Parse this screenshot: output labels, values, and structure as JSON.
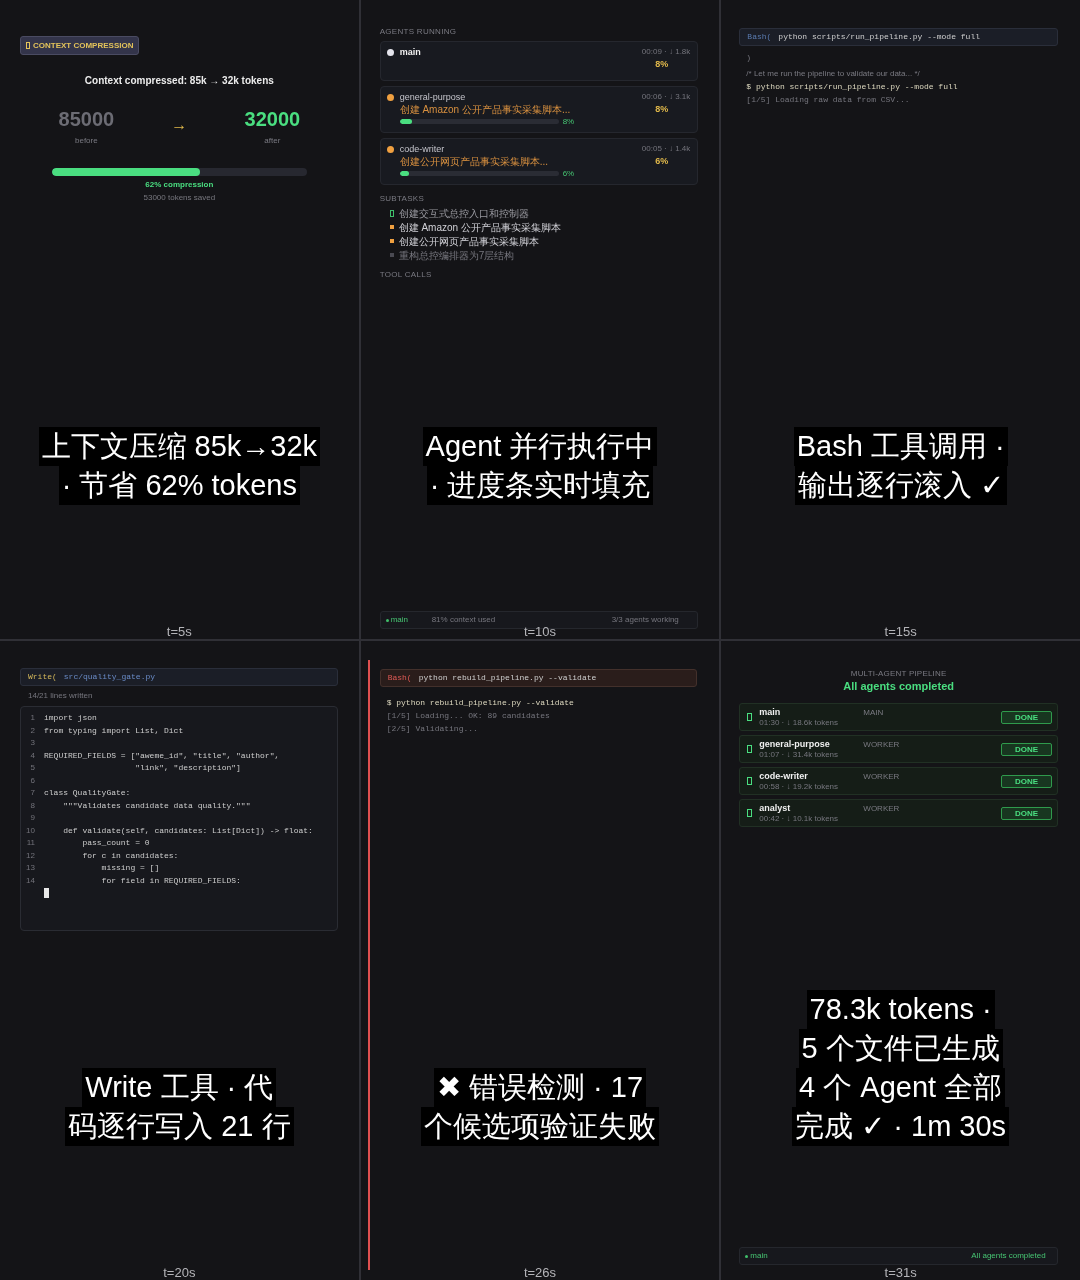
{
  "panels": [
    {
      "kind": "compression",
      "badge": "CONTEXT COMPRESSION",
      "title": "Context compressed: 85k → 32k tokens",
      "before": {
        "value": "85000",
        "label": "before"
      },
      "arrow": "→",
      "after": {
        "value": "32000",
        "label": "after"
      },
      "compression": {
        "level": 0.58,
        "label": "62% compression",
        "note": "53000 tokens saved"
      },
      "caption_lines": [
        "上下文压缩 85k→32k",
        "· 节省 62% tokens"
      ],
      "time_label": "t=5s"
    },
    {
      "kind": "agents",
      "agents_label": "AGENTS RUNNING",
      "agents": [
        {
          "name": "main",
          "kind": "main",
          "color": "#e4e4ec",
          "meta": "00:09 · ↓ 1.8k",
          "percent": "8%"
        },
        {
          "name": "general-purpose",
          "kind": "worker",
          "color": "#f0a040",
          "task": "创建 Amazon 公开产品事实采集脚本...",
          "level": 0.08,
          "bar_label": "8%",
          "meta": "00:06 · ↓ 3.1k",
          "percent": "8%"
        },
        {
          "name": "code-writer",
          "kind": "worker",
          "color": "#f0a040",
          "task": "创建公开网页产品事实采集脚本...",
          "level": 0.06,
          "bar_label": "6%",
          "meta": "00:05 · ↓ 1.4k",
          "percent": "6%"
        }
      ],
      "subtasks_label": "SUBTASKS",
      "subtasks": [
        {
          "text": "创建交互式总控入口和控制器",
          "kind": "done"
        },
        {
          "text": "创建 Amazon 公开产品事实采集脚本",
          "kind": "running"
        },
        {
          "text": "创建公开网页产品事实采集脚本",
          "kind": "running"
        },
        {
          "text": "重构总控编排器为7层结构",
          "kind": "pending"
        }
      ],
      "tool_calls_label": "TOOL CALLS",
      "status_bar": {
        "agent": "main",
        "context": "81% context used",
        "message": "3/3 agents working"
      },
      "caption_lines": [
        "Agent 并行执行中",
        "· 进度条实时填充"
      ],
      "time_label": "t=10s"
    },
    {
      "kind": "terminal",
      "header": {
        "tool": "Bash(",
        "kind": "bash",
        "argument": "python scripts/run_pipeline.py --mode full",
        "error": false
      },
      "lines": [
        {
          "kind": "plain",
          "text": ")"
        },
        {
          "kind": "comment",
          "text": "/* Let me run the pipeline to validate our data... */"
        },
        {
          "kind": "command",
          "text": "$ python scripts/run_pipeline.py --mode full"
        },
        {
          "kind": "output",
          "text": "[1/5] Loading raw data from CSV..."
        }
      ],
      "caption_lines": [
        "Bash 工具调用 ·",
        "输出逐行滚入 ✓"
      ],
      "time_label": "t=15s"
    },
    {
      "kind": "editor",
      "header": {
        "tool": "Write(",
        "kind": "write",
        "argument": "src/quality_gate.py",
        "error": false
      },
      "progress_text": "14/21 lines written",
      "code_lines": [
        {
          "number": "1",
          "text": "import json"
        },
        {
          "number": "2",
          "text": "from typing import List, Dict"
        },
        {
          "number": "3"
        },
        {
          "number": "4",
          "text": "REQUIRED_FIELDS = [\"aweme_id\", \"title\", \"author\","
        },
        {
          "number": "5",
          "text": "                   \"link\", \"description\"]"
        },
        {
          "number": "6"
        },
        {
          "number": "7",
          "text": "class QualityGate:"
        },
        {
          "number": "8",
          "text": "    \"\"\"Validates candidate data quality.\"\"\""
        },
        {
          "number": "9"
        },
        {
          "number": "10",
          "text": "    def validate(self, candidates: List[Dict]) -> float:"
        },
        {
          "number": "11",
          "text": "        pass_count = 0"
        },
        {
          "number": "12",
          "text": "        for c in candidates:"
        },
        {
          "number": "13",
          "text": "            missing = []"
        },
        {
          "number": "14",
          "text": "            for field in REQUIRED_FIELDS:"
        }
      ],
      "cursor": true,
      "caption_lines": [
        "Write 工具 · 代",
        "码逐行写入 21 行"
      ],
      "time_label": "t=20s"
    },
    {
      "kind": "terminal",
      "header": {
        "tool": "Bash(",
        "kind": "bash",
        "argument": "python rebuild_pipeline.py --validate",
        "error": true
      },
      "lines": [
        {
          "kind": "command",
          "text": "$ python rebuild_pipeline.py --validate"
        },
        {
          "kind": "output",
          "text": "[1/5] Loading... OK: 89 candidates"
        },
        {
          "kind": "output",
          "text": "[2/5] Validating..."
        }
      ],
      "caption_lines": [
        "✖ 错误检测 · 17",
        "个候选项验证失败"
      ],
      "time_label": "t=26s"
    },
    {
      "kind": "summary",
      "heading": "MULTI-AGENT PIPELINE",
      "status": "All agents completed",
      "agents": [
        {
          "name": "main",
          "meta": "01:30 · ↓ 18.6k tokens",
          "role": "MAIN",
          "state": "DONE"
        },
        {
          "name": "general-purpose",
          "meta": "01:07 · ↓ 31.4k tokens",
          "role": "WORKER",
          "state": "DONE"
        },
        {
          "name": "code-writer",
          "meta": "00:58 · ↓ 19.2k tokens",
          "role": "WORKER",
          "state": "DONE"
        },
        {
          "name": "analyst",
          "meta": "00:42 · ↓ 10.1k tokens",
          "role": "WORKER",
          "state": "DONE"
        }
      ],
      "status_bar": {
        "agent": "main",
        "message": "All agents completed"
      },
      "caption_lines": [
        "78.3k tokens ·",
        "5 个文件已生成",
        "4 个 Agent 全部",
        "完成 ✓ · 1m 30s"
      ],
      "time_label": "t=31s"
    }
  ]
}
